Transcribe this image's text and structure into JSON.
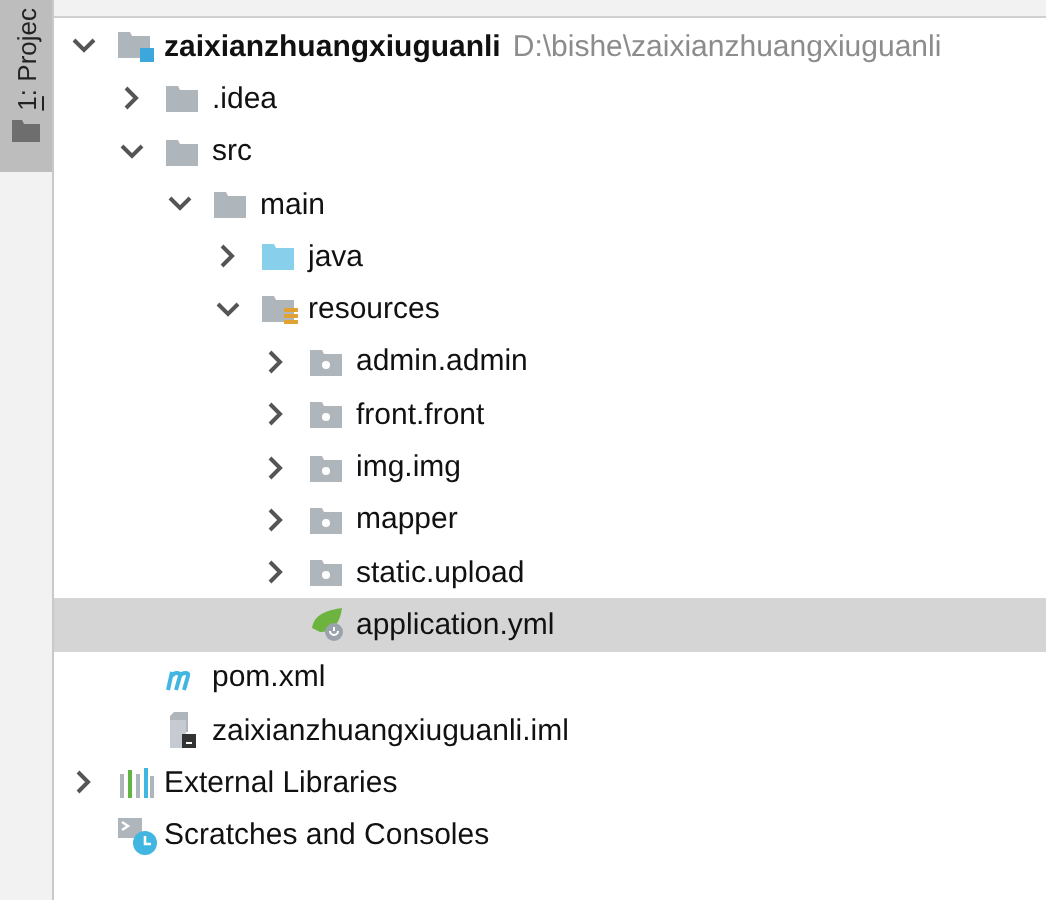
{
  "sidebar": {
    "tab": {
      "mnemonic": "1",
      "rest": ": Projec",
      "selected": true
    }
  },
  "tree": [
    {
      "label": "zaixianzhuangxiuguanli",
      "hint": "D:\\bishe\\zaixianzhuangxiuguanli",
      "kind": "module",
      "expanded": true,
      "selected": false,
      "children": [
        {
          "label": ".idea",
          "kind": "folder",
          "expanded": false,
          "selected": false
        },
        {
          "label": "src",
          "kind": "folder",
          "expanded": true,
          "selected": false,
          "children": [
            {
              "label": "main",
              "kind": "folder",
              "expanded": true,
              "selected": false,
              "children": [
                {
                  "label": "java",
                  "kind": "source-folder",
                  "expanded": false,
                  "selected": false
                },
                {
                  "label": "resources",
                  "kind": "resources-folder",
                  "expanded": true,
                  "selected": false,
                  "children": [
                    {
                      "label": "admin.admin",
                      "kind": "package",
                      "expanded": false,
                      "selected": false
                    },
                    {
                      "label": "front.front",
                      "kind": "package",
                      "expanded": false,
                      "selected": false
                    },
                    {
                      "label": "img.img",
                      "kind": "package",
                      "expanded": false,
                      "selected": false
                    },
                    {
                      "label": "mapper",
                      "kind": "package",
                      "expanded": false,
                      "selected": false
                    },
                    {
                      "label": "static.upload",
                      "kind": "package",
                      "expanded": false,
                      "selected": false
                    },
                    {
                      "label": "application.yml",
                      "kind": "spring-file",
                      "selected": true
                    }
                  ]
                }
              ]
            }
          ]
        },
        {
          "label": "pom.xml",
          "kind": "maven",
          "selected": false
        },
        {
          "label": "zaixianzhuangxiuguanli.iml",
          "kind": "iml",
          "selected": false
        }
      ]
    },
    {
      "label": "External Libraries",
      "kind": "libraries",
      "expanded": false,
      "selected": false
    },
    {
      "label": "Scratches and Consoles",
      "kind": "scratches",
      "selected": false
    }
  ]
}
